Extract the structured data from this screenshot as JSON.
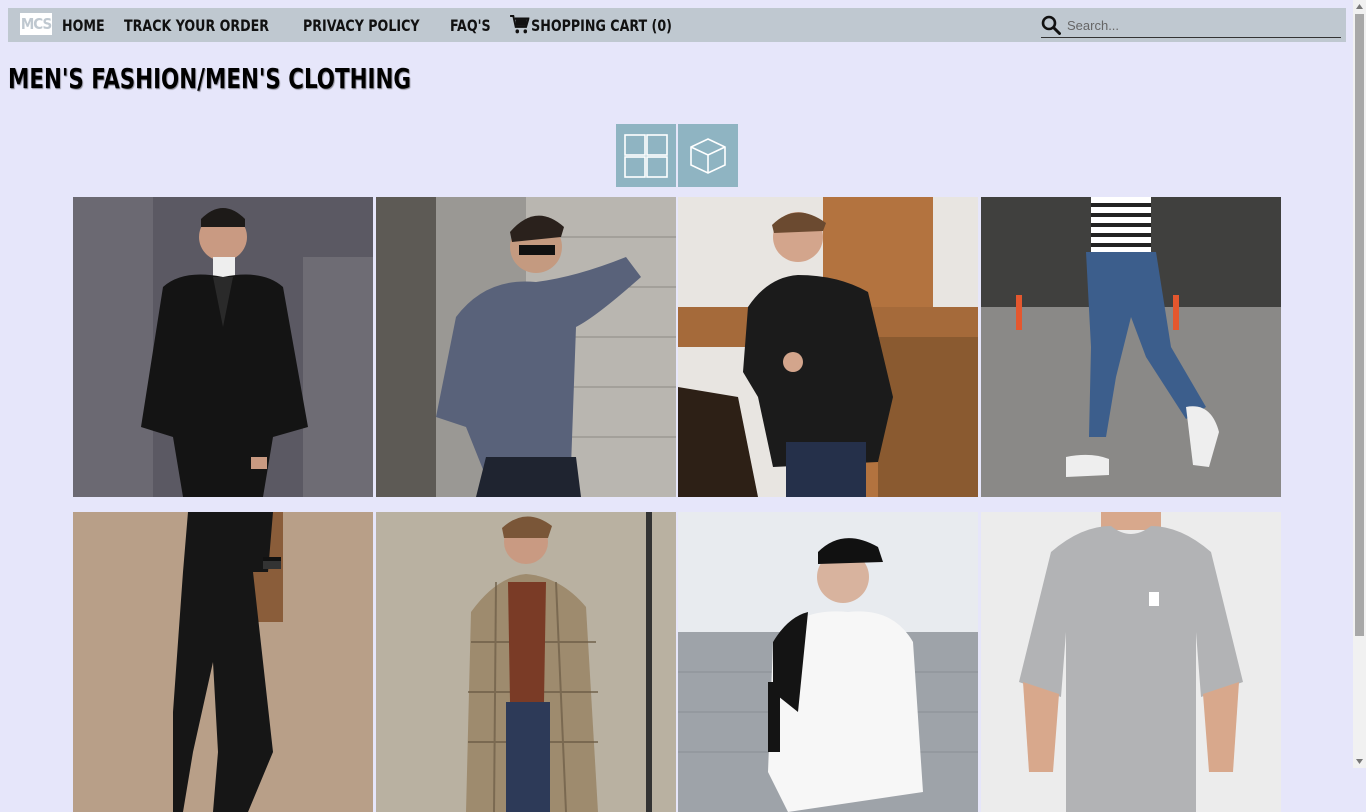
{
  "nav": {
    "logo": "MCS",
    "links": [
      "HOME",
      "TRACK YOUR ORDER",
      "PRIVACY POLICY",
      "FAQ'S"
    ],
    "cart_label": "SHOPPING CART (0)",
    "search_placeholder": "Search..."
  },
  "page": {
    "title": "MEN'S FASHION/MEN'S CLOTHING"
  },
  "view_toggle": {
    "icons": [
      "grid-view-icon",
      "3d-cube-view-icon"
    ]
  },
  "products": [
    {
      "item": "black suit"
    },
    {
      "item": "grey hoodie"
    },
    {
      "item": "black leather jacket"
    },
    {
      "item": "blue jeans"
    },
    {
      "item": "black jogger pants"
    },
    {
      "item": "plaid overcoat"
    },
    {
      "item": "white sweatshirt"
    },
    {
      "item": "grey t-shirt"
    }
  ],
  "colors": {
    "background": "#e6e6fa",
    "navbar": "#bfc8d0",
    "toggle": "#8fb4c2"
  }
}
